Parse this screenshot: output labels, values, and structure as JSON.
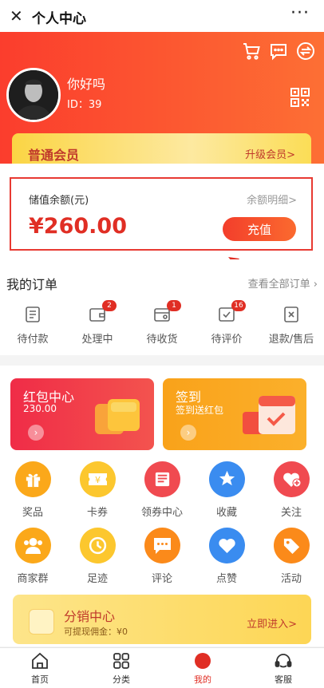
{
  "window": {
    "title": "个人中心",
    "close_glyph": "✕",
    "more_glyph": "···"
  },
  "header": {
    "icons": [
      "cart-icon",
      "message-icon",
      "switch-icon"
    ],
    "user_name": "你好吗",
    "user_id": "ID：39"
  },
  "member": {
    "level": "普通会员",
    "upgrade": "升级会员>"
  },
  "balance": {
    "label": "储值余额(元)",
    "detail_link": "余额明细>",
    "amount": "¥260.00",
    "recharge_button": "充值"
  },
  "orders": {
    "title": "我的订单",
    "view_all": "查看全部订单",
    "items": [
      {
        "label": "待付款",
        "badge": ""
      },
      {
        "label": "处理中",
        "badge": "2"
      },
      {
        "label": "待收货",
        "badge": "1"
      },
      {
        "label": "待评价",
        "badge": "16"
      },
      {
        "label": "退款/售后",
        "badge": ""
      }
    ]
  },
  "cards": {
    "red_packet": {
      "title": "红包中心",
      "subtitle": "230.00",
      "color": "#f03a4a"
    },
    "sign_in": {
      "title": "签到",
      "subtitle": "签到送红包",
      "color": "#fba81a"
    }
  },
  "grid": [
    {
      "label": "奖品",
      "icon": "gift-icon",
      "color": "#fba81a"
    },
    {
      "label": "卡券",
      "icon": "coupon-icon",
      "color": "#fcc72e"
    },
    {
      "label": "领券中心",
      "icon": "coupon-center-icon",
      "color": "#f04a50"
    },
    {
      "label": "收藏",
      "icon": "star-icon",
      "color": "#3a8cf0"
    },
    {
      "label": "关注",
      "icon": "heart-plus-icon",
      "color": "#f04a50"
    },
    {
      "label": "商家群",
      "icon": "group-icon",
      "color": "#fba81a"
    },
    {
      "label": "足迹",
      "icon": "clock-icon",
      "color": "#fcc72e"
    },
    {
      "label": "评论",
      "icon": "comment-icon",
      "color": "#fb8a1a"
    },
    {
      "label": "点赞",
      "icon": "heart-icon",
      "color": "#3a8cf0"
    },
    {
      "label": "活动",
      "icon": "tag-icon",
      "color": "#fb8a1a"
    }
  ],
  "distribution": {
    "title": "分销中心",
    "subtitle": "可提现佣金：¥0",
    "enter": "立即进入>"
  },
  "tabbar": [
    {
      "label": "首页",
      "icon": "home-icon"
    },
    {
      "label": "分类",
      "icon": "category-icon"
    },
    {
      "label": "我的",
      "icon": "me-icon"
    },
    {
      "label": "客服",
      "icon": "service-icon"
    }
  ],
  "colors": {
    "accent": "#e02e24",
    "header_from": "#fb3d2d",
    "header_to": "#fd6f34"
  }
}
